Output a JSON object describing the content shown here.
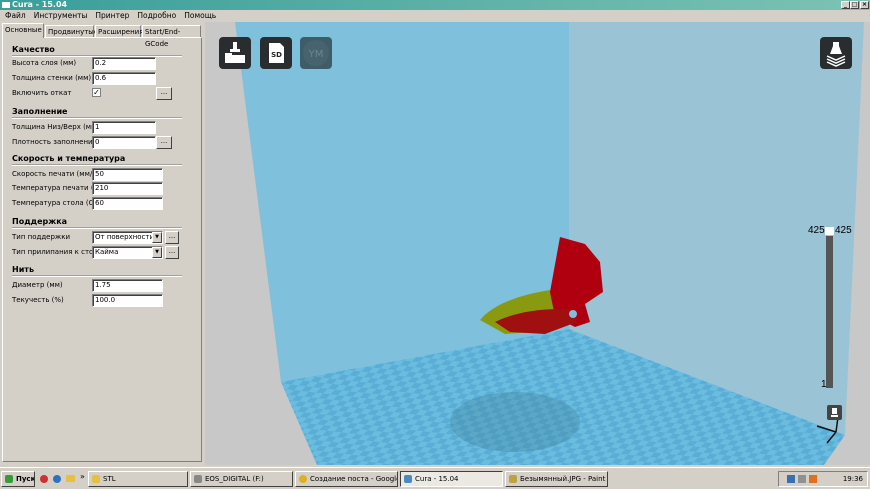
{
  "window": {
    "title": "Cura - 15.04",
    "controls": [
      "_",
      "□",
      "×"
    ]
  },
  "menu": [
    "Файл",
    "Инструменты",
    "Принтер",
    "Подробно",
    "Помощь"
  ],
  "tabs": [
    {
      "label": "Основные",
      "active": true
    },
    {
      "label": "Продвинутые"
    },
    {
      "label": "Расширения"
    },
    {
      "label": "Start/End-GCode"
    }
  ],
  "settings": {
    "quality": {
      "title": "Качество",
      "layer_height_label": "Высота слоя (мм)",
      "layer_height": "0.2",
      "wall_label": "Толщина стенки (мм)",
      "wall": "0.6",
      "retract_label": "Включить откат",
      "retract_checked": true,
      "more": "..."
    },
    "fill": {
      "title": "Заполнение",
      "bottom_top_label": "Толщина Низ/Верх (мм)",
      "bottom_top": "1",
      "density_label": "Плотность заполнения",
      "density": "0",
      "more": "..."
    },
    "speed": {
      "title": "Скорость и температура",
      "speed_label": "Скорость печати (мм/с)",
      "speed": "50",
      "temp_label": "Температура печати (С)",
      "temp": "210",
      "bed_label": "Температура стола (С)",
      "bed": "60"
    },
    "support": {
      "title": "Поддержка",
      "type_label": "Тип поддержки",
      "type": "От поверхности",
      "adhesion_label": "Тип прилипания к столу",
      "adhesion": "Кайма",
      "more": "..."
    },
    "filament": {
      "title": "Нить",
      "diameter_label": "Диаметр (мм)",
      "diameter": "1.75",
      "flow_label": "Текучесть (%)",
      "flow": "100.0"
    }
  },
  "viewport": {
    "toolbar": [
      {
        "icon": "load-icon"
      },
      {
        "icon": "sd-card-icon",
        "text": "SD"
      },
      {
        "icon": "youmagine-icon",
        "text": "YM"
      }
    ],
    "view_mode_icon": "layers-view-icon",
    "layer_slider": {
      "max_left": "425",
      "max_right": "425",
      "min": "1",
      "value_fraction": 1.0
    },
    "colors": {
      "wall_back": "#7fc0dc",
      "wall_right": "#9ac4d6",
      "floor_a": "#6bbde0",
      "floor_b": "#5aaed6",
      "model_red": "#b00010",
      "model_yellow": "#8a9a10"
    }
  },
  "taskbar": {
    "start": "Пуск",
    "items": [
      {
        "label": "STL"
      },
      {
        "label": "EOS_DIGITAL (F:)"
      },
      {
        "label": "Создание поста - Google..."
      },
      {
        "label": "Cura - 15.04",
        "active": true
      },
      {
        "label": "Безымянный.JPG - Paint"
      }
    ],
    "clock": "19:36",
    "more": "»"
  }
}
